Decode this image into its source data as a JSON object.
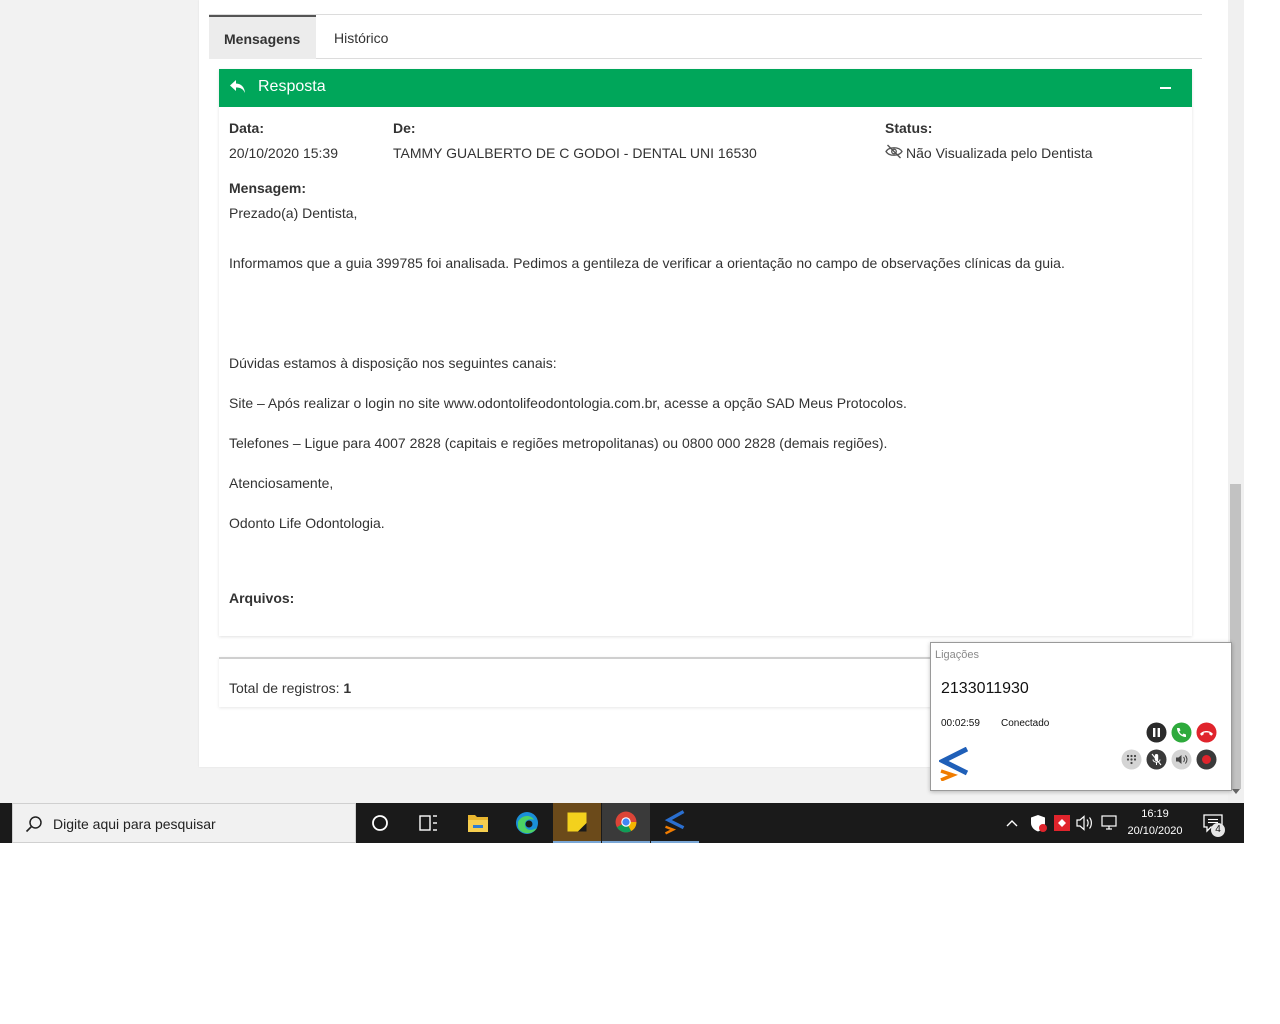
{
  "tabs": [
    {
      "label": "Mensagens",
      "active": true
    },
    {
      "label": "Histórico",
      "active": false
    }
  ],
  "panel": {
    "title": "Resposta",
    "header_color": "#00a65a",
    "data_label": "Data:",
    "data_value": "20/10/2020 15:39",
    "de_label": "De:",
    "de_value": "TAMMY GUALBERTO DE C GODOI - DENTAL UNI 16530",
    "status_label": "Status:",
    "status_value": "Não Visualizada pelo Dentista",
    "mensagem_label": "Mensagem:",
    "message_lines": [
      "Prezado(a) Dentista,",
      "Informamos que a guia 399785 foi analisada. Pedimos a gentileza de verificar a orientação no campo de observações clínicas da guia.",
      "Dúvidas estamos à disposição nos seguintes canais:",
      "Site – Após realizar o login no site www.odontolifeodontologia.com.br, acesse a opção SAD Meus Protocolos.",
      "Telefones – Ligue para 4007 2828 (capitais e regiões metropolitanas) ou 0800 000 2828 (demais regiões).",
      "Atenciosamente,",
      "Odonto Life Odontologia."
    ],
    "arquivos_label": "Arquivos:"
  },
  "footer": {
    "total_label": "Total de registros:",
    "total_value": "1"
  },
  "softphone": {
    "title": "Ligações",
    "number": "2133011930",
    "timer": "00:02:59",
    "status": "Conectado"
  },
  "taskbar": {
    "search_placeholder": "Digite aqui para pesquisar",
    "time": "16:19",
    "date": "20/10/2020",
    "notification_count": "4"
  }
}
